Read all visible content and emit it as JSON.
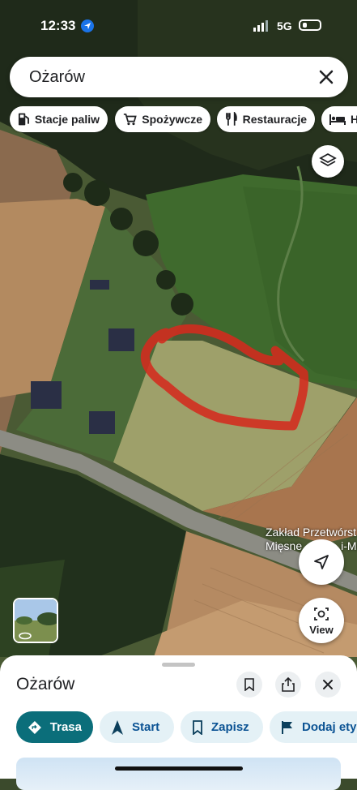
{
  "status_bar": {
    "time": "12:33",
    "network": "5G"
  },
  "search": {
    "query": "Ożarów"
  },
  "category_chips": [
    {
      "label": "Stacje paliw",
      "icon": "fuel-icon"
    },
    {
      "label": "Spożywcze",
      "icon": "cart-icon"
    },
    {
      "label": "Restauracje",
      "icon": "fork-knife-icon"
    },
    {
      "label": "Ho",
      "icon": "bed-icon"
    }
  ],
  "map": {
    "place_label_line1": "Zakład Przetwórst",
    "place_label_line2": "Mięsne",
    "place_label_line2_tail": "i-Ma",
    "annotation_color": "#d42a1e"
  },
  "map_controls": {
    "view_label": "View"
  },
  "place_sheet": {
    "title": "Ożarów",
    "actions": [
      {
        "label": "Trasa",
        "icon": "directions-icon"
      },
      {
        "label": "Start",
        "icon": "navigation-arrow-icon"
      },
      {
        "label": "Zapisz",
        "icon": "bookmark-icon"
      },
      {
        "label": "Dodaj etyk",
        "icon": "flag-icon"
      }
    ]
  }
}
